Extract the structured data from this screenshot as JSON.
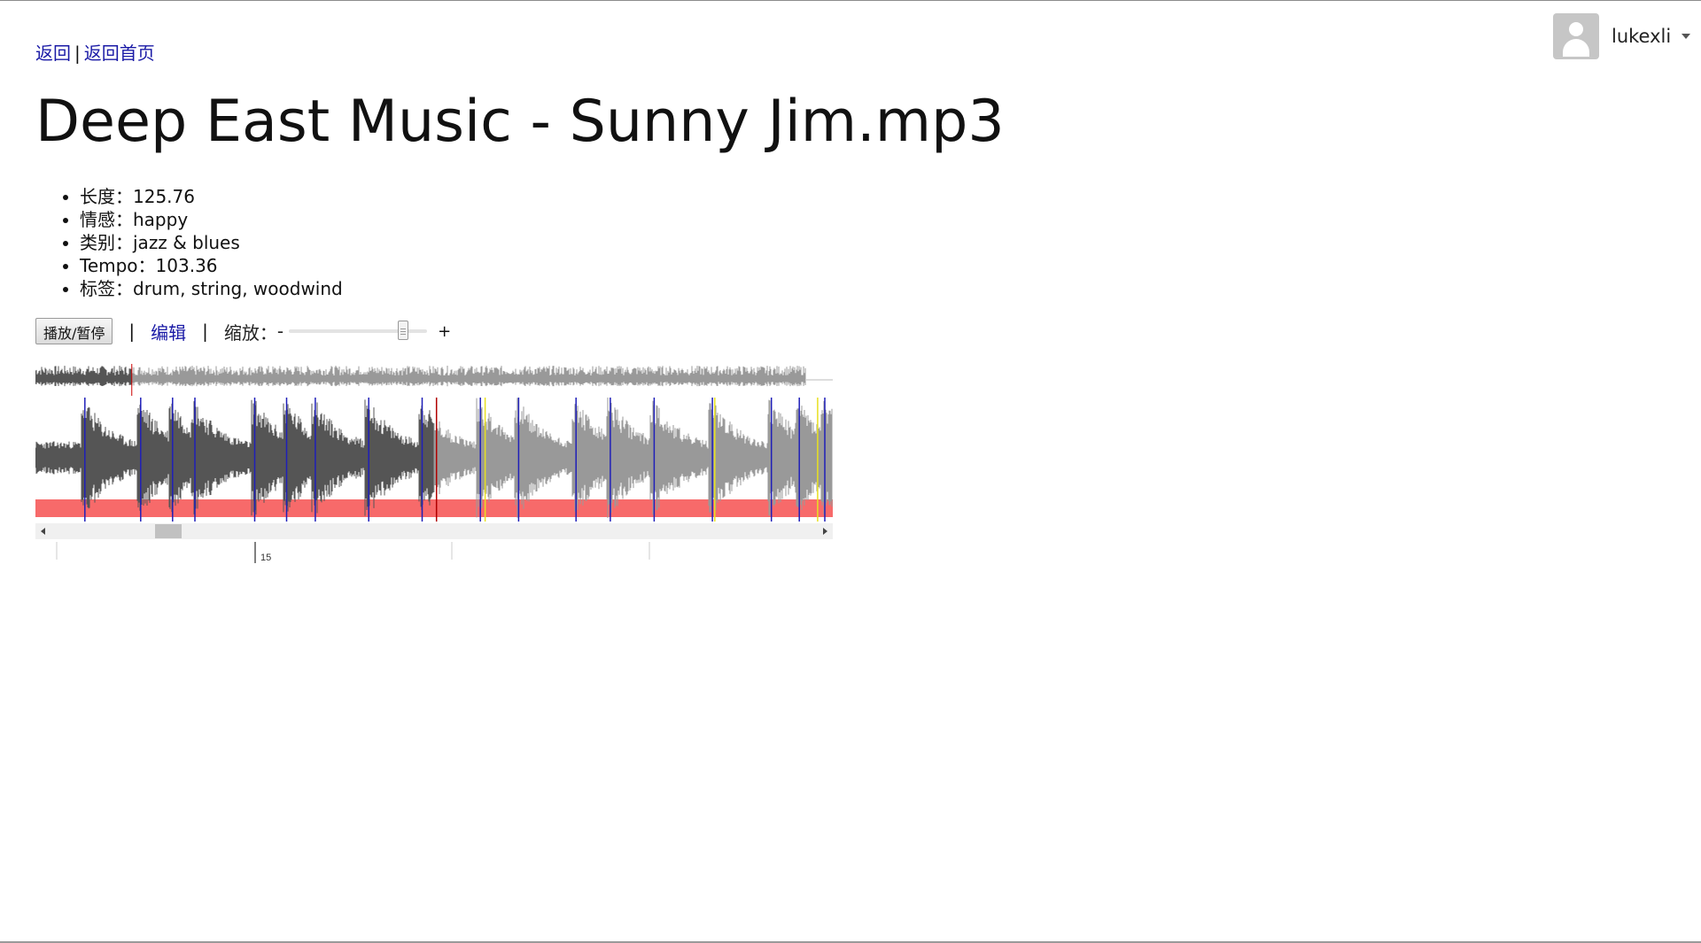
{
  "nav": {
    "back": "返回",
    "separator": "|",
    "home": "返回首页"
  },
  "user": {
    "name": "lukexli",
    "avatar_icon": "user-avatar-icon",
    "menu_icon": "caret-down-icon"
  },
  "title": "Deep East Music - Sunny Jim.mp3",
  "meta": [
    {
      "label": "长度：",
      "value": "125.76"
    },
    {
      "label": "情感：",
      "value": "happy"
    },
    {
      "label": "类别：",
      "value": "jazz & blues"
    },
    {
      "label": "Tempo：",
      "value": "103.36"
    },
    {
      "label": "标签：",
      "value": "drum, string, woodwind"
    }
  ],
  "controls": {
    "play_pause": "播放/暂停",
    "divider": "|",
    "edit": "编辑",
    "zoom_label": "缩放：",
    "zoom_minus": "-",
    "zoom_plus": "+",
    "zoom_level": 0.85
  },
  "waveform": {
    "played_color": "#555555",
    "unplayed_color": "#999999",
    "cursor_color": "#cc0000",
    "region_color": "#f76a6a",
    "overview_progress": 0.125,
    "detail_progress": 0.5,
    "blue_markers": [
      0.062,
      0.132,
      0.172,
      0.2,
      0.275,
      0.315,
      0.351,
      0.418,
      0.485,
      0.558,
      0.606,
      0.678,
      0.721,
      0.776,
      0.849,
      0.923,
      0.958,
      0.99
    ],
    "yellow_markers": [
      0.564,
      0.852,
      0.981
    ],
    "red_markers": [
      0.503
    ],
    "scroll_position": 0.14
  },
  "timeline": {
    "label": "15"
  }
}
